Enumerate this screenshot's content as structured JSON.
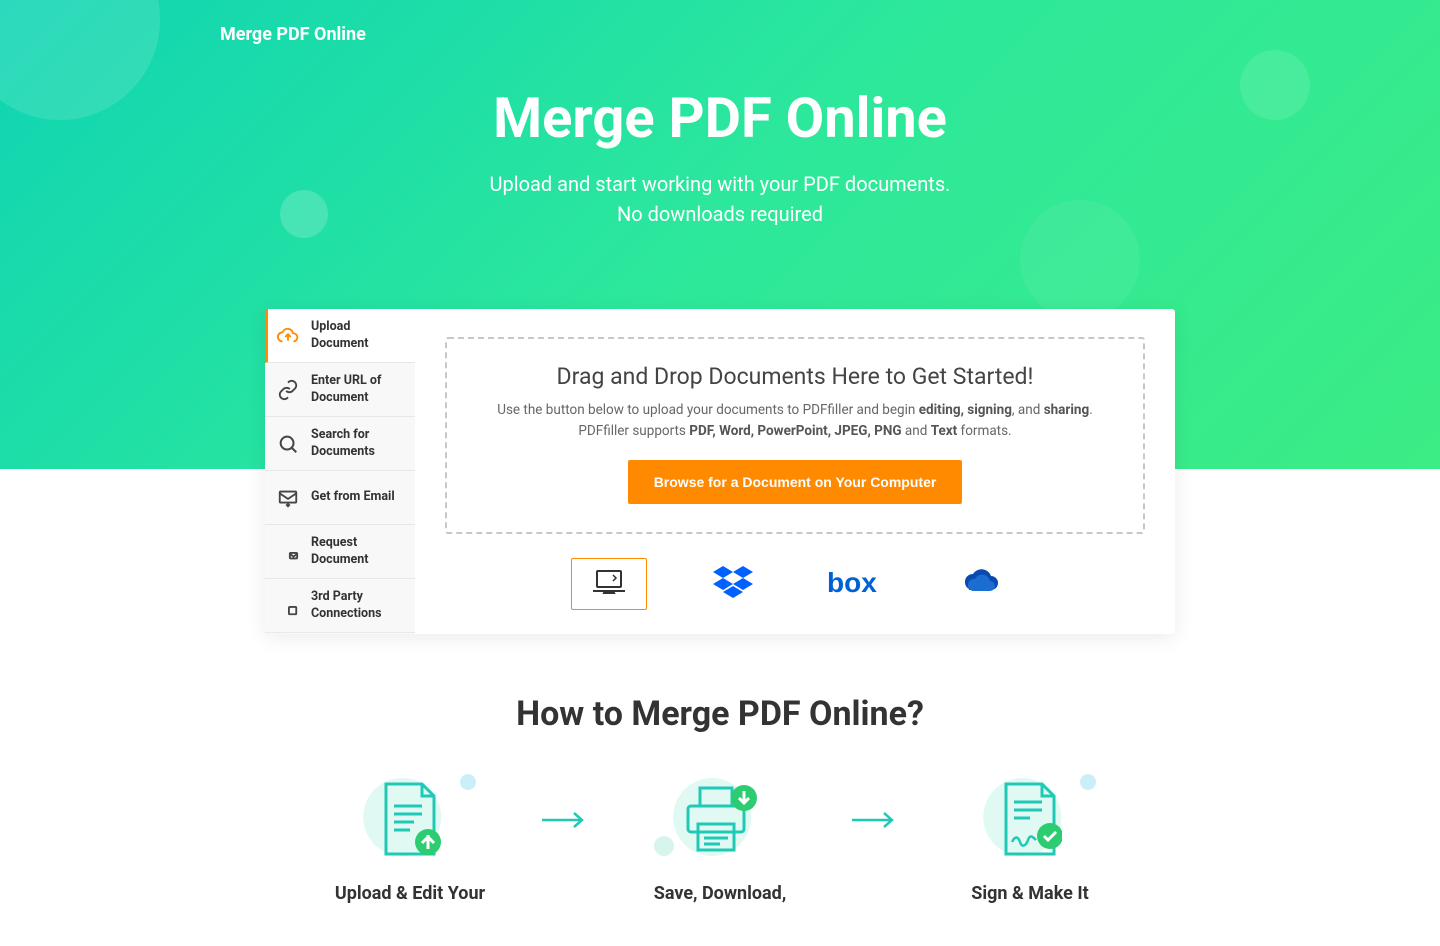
{
  "brand": "Merge PDF Online",
  "hero": {
    "title": "Merge PDF Online",
    "subtitle1": "Upload and start working with your PDF documents.",
    "subtitle2": "No downloads required"
  },
  "sidebar": {
    "items": [
      {
        "label": "Upload Document"
      },
      {
        "label": "Enter URL of Document"
      },
      {
        "label": "Search for Documents"
      },
      {
        "label": "Get from Email"
      },
      {
        "label": "Request Document"
      },
      {
        "label": "3rd Party Connections"
      }
    ]
  },
  "dropzone": {
    "title": "Drag and Drop Documents Here to Get Started!",
    "line1_pre": "Use the button below to upload your documents to PDFfiller and begin ",
    "line1_bold": "editing, signing",
    "line1_mid": ", and ",
    "line1_bold2": "sharing",
    "line1_post": ".",
    "line2_pre": "PDFfiller supports ",
    "line2_bold": "PDF, Word, PowerPoint, JPEG, PNG",
    "line2_mid": " and ",
    "line2_bold2": "Text",
    "line2_post": " formats.",
    "button": "Browse for a Document on Your Computer"
  },
  "sources": {
    "computer": "computer",
    "dropbox": "dropbox",
    "box": "box",
    "onedrive": "onedrive"
  },
  "how": {
    "title": "How to Merge PDF Online?",
    "steps": [
      {
        "title": "Upload & Edit Your"
      },
      {
        "title": "Save, Download,"
      },
      {
        "title": "Sign & Make It"
      }
    ]
  }
}
